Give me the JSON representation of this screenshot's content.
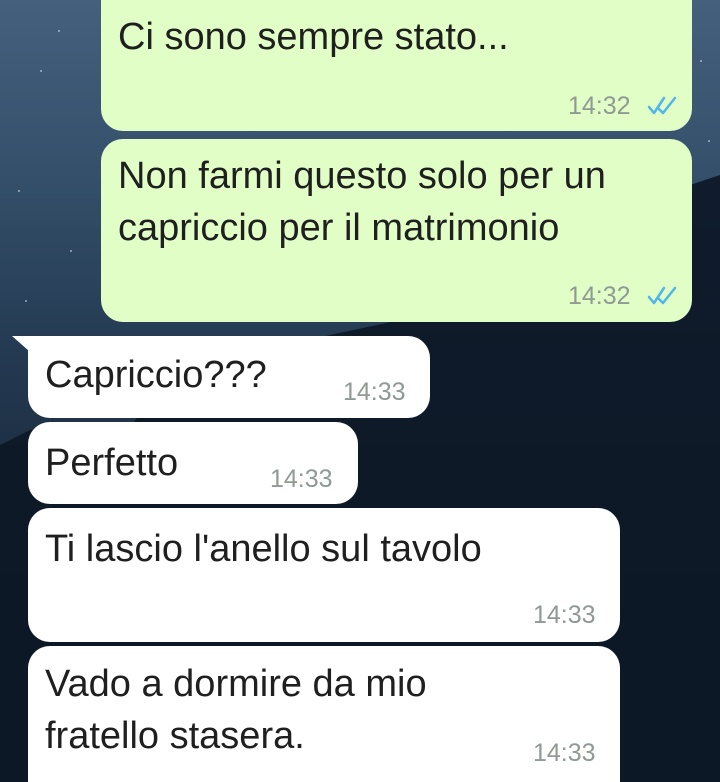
{
  "messages": [
    {
      "direction": "outgoing",
      "text": "Ci sono sempre stato...",
      "time": "14:32",
      "status": "read"
    },
    {
      "direction": "outgoing",
      "lines": [
        "Non farmi questo solo per un",
        "capriccio per il matrimonio"
      ],
      "time": "14:32",
      "status": "read"
    },
    {
      "direction": "incoming",
      "text": "Capriccio???",
      "time": "14:33"
    },
    {
      "direction": "incoming",
      "text": "Perfetto",
      "time": "14:33"
    },
    {
      "direction": "incoming",
      "text": "Ti lascio l'anello sul tavolo",
      "time": "14:33"
    },
    {
      "direction": "incoming",
      "lines": [
        "Vado a dormire da mio",
        "fratello stasera."
      ],
      "time": "14:33"
    }
  ],
  "colors": {
    "outgoing_bubble": "#e1fec6",
    "incoming_bubble": "#ffffff",
    "read_ticks": "#4fb6ec",
    "timestamp": "#8f9a94"
  },
  "icons": {
    "read_status": "double-check-icon"
  }
}
